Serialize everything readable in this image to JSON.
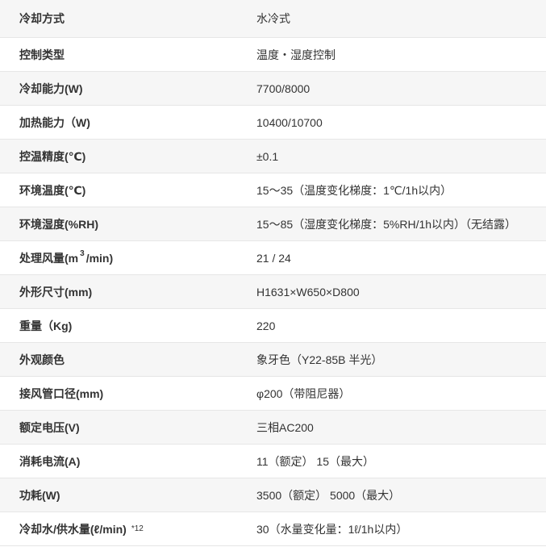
{
  "specs": [
    {
      "label": "冷却方式",
      "value": "水冷式"
    },
    {
      "label": "控制类型",
      "value": "温度・湿度控制"
    },
    {
      "label": "冷却能力(W)",
      "value": "7700/8000"
    },
    {
      "label": "加热能力（W)",
      "value": "10400/10700"
    },
    {
      "label": "控温精度(℃)",
      "value": "±0.1"
    },
    {
      "label": "环境温度(℃)",
      "value": "15～35（温度变化梯度：1℃/1h以内）"
    },
    {
      "label": "环境湿度(%RH)",
      "value": "15～85（湿度变化梯度：5%RH/1h以内）（无结露）"
    },
    {
      "label_pre": "处理风量(m",
      "label_sup": "3",
      "label_post": "/min)",
      "value": "21 / 24"
    },
    {
      "label": "外形尺寸(mm)",
      "value": "H1631×W650×D800"
    },
    {
      "label": "重量（Kg)",
      "value": "220"
    },
    {
      "label": "外观颜色",
      "value": "象牙色（Y22-85B 半光）"
    },
    {
      "label": "接风管口径(mm)",
      "value": "φ200（带阻尼器）"
    },
    {
      "label": "额定电压(V)",
      "value": "三相AC200"
    },
    {
      "label": "消耗电流(A)",
      "value": "11（额定） 15（最大）"
    },
    {
      "label": "功耗(W)",
      "value": "3500（额定） 5000（最大）"
    },
    {
      "label": "冷却水/供水量(ℓ/min)",
      "label_note": "*12",
      "value": "30（水量变化量：1ℓ/1h以内）"
    }
  ]
}
